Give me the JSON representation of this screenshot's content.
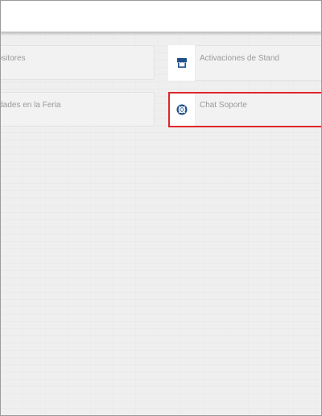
{
  "menu": {
    "items": [
      {
        "label": "Expositores",
        "visible_label": "positores"
      },
      {
        "label": "Activaciones de Stand",
        "icon": "stand-icon"
      },
      {
        "label": "Actividades en la Feria",
        "visible_label": "vidades en la Feria"
      },
      {
        "label": "Chat Soporte",
        "icon": "lifebuoy-icon"
      }
    ]
  },
  "colors": {
    "background": "#efefef",
    "card": "#f2f2f2",
    "label": "#9a9a9a",
    "icon": "#1f4f8a",
    "highlight": "#e0262b"
  }
}
